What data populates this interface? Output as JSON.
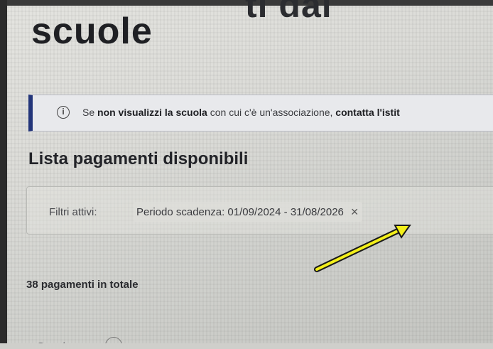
{
  "page": {
    "title_top_fragment": "ti dai",
    "title": "scuole"
  },
  "notice": {
    "icon": "info-icon",
    "prefix": "Se ",
    "bold1": "non visualizzi la scuola",
    "middle": " con cui c'è un'associazione, ",
    "bold2": "contatta l'istit"
  },
  "section": {
    "title": "Lista pagamenti disponibili"
  },
  "filters": {
    "label": "Filtri attivi:",
    "chip_text": "Periodo scadenza: 01/09/2024 - 31/08/2026",
    "chip_close_glyph": "×"
  },
  "summary": {
    "total_text": "38 pagamenti in totale"
  },
  "bottom": {
    "label": "Scuola",
    "info_icon": "info-icon"
  },
  "annotation": {
    "arrow_color": "#f3ef1a"
  }
}
